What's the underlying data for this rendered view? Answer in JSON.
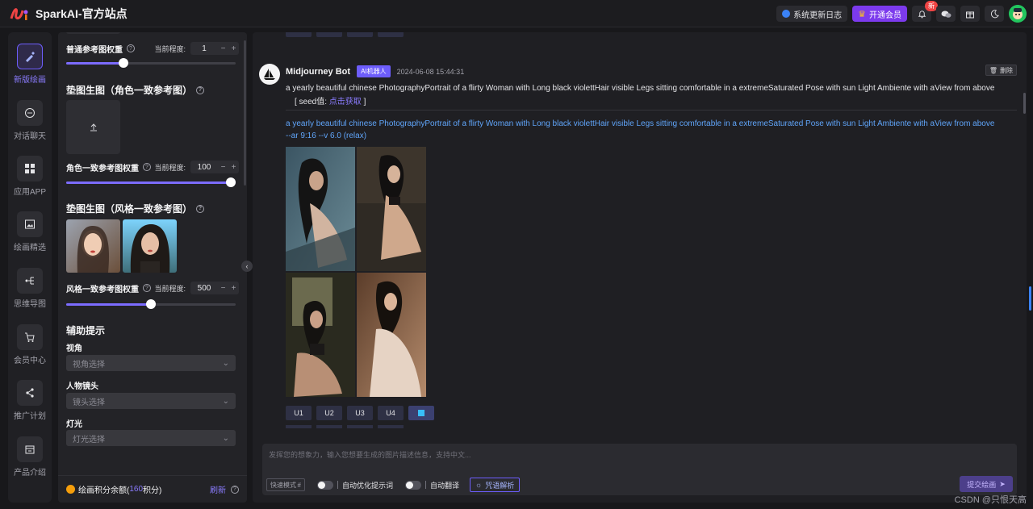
{
  "app": {
    "name": "SparkAI-官方站点"
  },
  "topbar": {
    "changelog": "系统更新日志",
    "vip": "开通会员",
    "notify_badge": "新"
  },
  "rail": [
    {
      "label": "新版绘画",
      "icon": "brush-icon",
      "active": true
    },
    {
      "label": "对话聊天",
      "icon": "chat-icon"
    },
    {
      "label": "应用APP",
      "icon": "apps-icon"
    },
    {
      "label": "绘画精选",
      "icon": "image-icon"
    },
    {
      "label": "思维导图",
      "icon": "mindmap-icon"
    },
    {
      "label": "会员中心",
      "icon": "cart-icon"
    },
    {
      "label": "推广计划",
      "icon": "share-icon"
    },
    {
      "label": "产品介绍",
      "icon": "box-icon"
    }
  ],
  "panel": {
    "normal_weight": {
      "label": "普通参考图权重",
      "degree_label": "当前程度:",
      "value": "1",
      "fraction": 0.34
    },
    "char_section": "垫图生图（角色一致参考图）",
    "char_weight": {
      "label": "角色一致参考图权重",
      "degree_label": "当前程度:",
      "value": "100",
      "fraction": 1.0
    },
    "style_section": "垫图生图（风格一致参考图）",
    "style_weight": {
      "label": "风格一致参考图权重",
      "degree_label": "当前程度:",
      "value": "500",
      "fraction": 0.5
    },
    "aux_title": "辅助提示",
    "view": {
      "label": "视角",
      "placeholder": "视角选择"
    },
    "lens": {
      "label": "人物镜头",
      "placeholder": "镜头选择"
    },
    "light": {
      "label": "灯光",
      "placeholder": "灯光选择"
    },
    "footer": {
      "credits_prefix": "绘画积分余额(",
      "credits_value": "160",
      "credits_suffix": "积分)",
      "refresh": "刷新"
    }
  },
  "message": {
    "bot_name": "Midjourney Bot",
    "tag": "AI机器人",
    "time": "2024-06-08 15:44:31",
    "delete": "删除",
    "prompt": "a yearly beautiful chinese PhotographyPortrait of a flirty Woman with Long black violettHair visible Legs sitting comfortable in a extremeSaturated Pose with sun Light Ambiente with aView from above",
    "seed_prefix": "[ seed值:",
    "seed_link": "点击获取",
    "seed_suffix": "]",
    "full_prompt_line1": "a yearly beautiful chinese PhotographyPortrait of a flirty Woman with Long black violettHair visible Legs sitting comfortable in a extremeSaturated Pose with sun Light Ambiente with aView from above",
    "full_prompt_line2": "--ar 9:16 --v 6.0  (relax)",
    "buttons": [
      "U1",
      "U2",
      "U3",
      "U4"
    ]
  },
  "composer": {
    "placeholder": "发挥您的想象力，输入您想要生成的图片描述信息，支持中文...",
    "mode_placeholder": "快速模式",
    "auto_optimize": "自动优化提示词",
    "auto_translate": "自动翻译",
    "parse": "咒语解析",
    "submit": "提交绘画"
  },
  "watermark": "CSDN @只恨天高",
  "colors": {
    "accent": "#6d5dfc",
    "link": "#60a5fa",
    "vip": "#7c3aed"
  }
}
